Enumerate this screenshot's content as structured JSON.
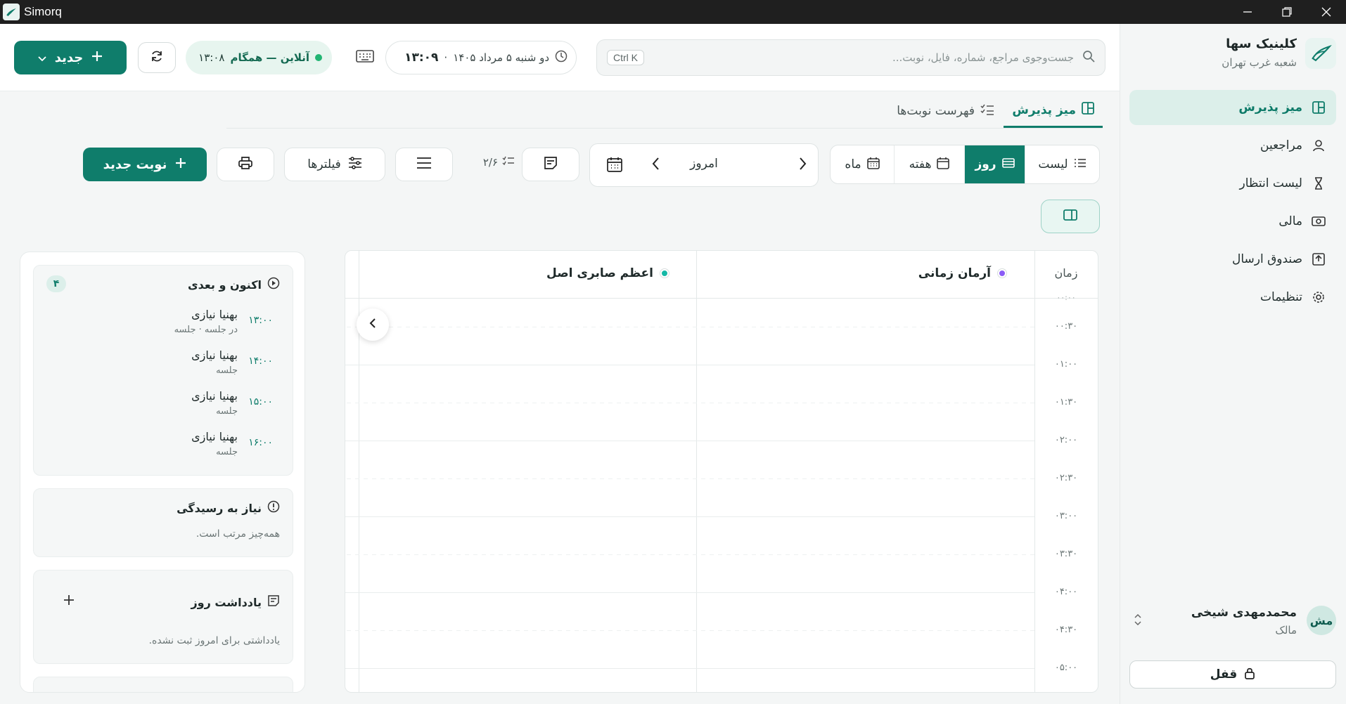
{
  "window": {
    "title": "Simorq"
  },
  "brand": {
    "name": "کلینیک سها",
    "branch": "شعبه غرب تهران"
  },
  "sidebar": {
    "items": [
      {
        "label": "میز پذیرش",
        "icon": "dashboard-icon",
        "active": true
      },
      {
        "label": "مراجعین",
        "icon": "user-icon"
      },
      {
        "label": "لیست انتظار",
        "icon": "hourglass-icon"
      },
      {
        "label": "مالی",
        "icon": "money-icon"
      },
      {
        "label": "صندوق ارسال",
        "icon": "outbox-icon"
      },
      {
        "label": "تنظیمات",
        "icon": "gear-icon"
      }
    ],
    "user": {
      "initials": "مش",
      "name": "محمدمهدی شیخی",
      "role": "مالک"
    },
    "lock_label": "قفل"
  },
  "header": {
    "search_placeholder": "جست‌وجوی مراجع، شماره، فایل، نوبت...",
    "search_shortcut": "Ctrl K",
    "date_text": "دو شنبه ۵ مرداد ۱۴۰۵",
    "time_text": "۱۳:۰۹",
    "online_label": "آنلاین — همگام",
    "online_time": "۱۳:۰۸",
    "new_label": "جدید"
  },
  "tabs": [
    {
      "label": "میز پذیرش",
      "active": true
    },
    {
      "label": "فهرست نوبت‌ها",
      "active": false
    }
  ],
  "toolbar": {
    "views": [
      {
        "label": "لیست",
        "active": false
      },
      {
        "label": "روز",
        "active": true
      },
      {
        "label": "هفته",
        "active": false
      },
      {
        "label": "ماه",
        "active": false
      }
    ],
    "today_label": "امروز",
    "count_label": "۲/۶",
    "filters_label": "فیلترها",
    "new_appointment_label": "نوبت جدید"
  },
  "schedule": {
    "time_header": "زمان",
    "providers": [
      {
        "name": "آرمان زمانی",
        "color": "#8b5cf6"
      },
      {
        "name": "اعظم صابری اصل",
        "color": "#14b8a6"
      }
    ],
    "times": [
      "۰۰:۳۰",
      "۰۱:۰۰",
      "۰۱:۳۰",
      "۰۲:۰۰",
      "۰۲:۳۰",
      "۰۳:۰۰",
      "۰۳:۳۰",
      "۰۴:۰۰",
      "۰۴:۳۰",
      "۰۵:۰۰"
    ]
  },
  "panel": {
    "now_next": {
      "title": "اکنون و بعدی",
      "count": "۴",
      "items": [
        {
          "name": "بهنیا نیازی",
          "time": "۱۳:۰۰",
          "sub": "در جلسه · جلسه"
        },
        {
          "name": "بهنیا نیازی",
          "time": "۱۴:۰۰",
          "sub": "جلسه"
        },
        {
          "name": "بهنیا نیازی",
          "time": "۱۵:۰۰",
          "sub": "جلسه"
        },
        {
          "name": "بهنیا نیازی",
          "time": "۱۶:۰۰",
          "sub": "جلسه"
        }
      ]
    },
    "attention": {
      "title": "نیاز به رسیدگی",
      "text": "همه‌چیز مرتب است."
    },
    "notes": {
      "title": "یادداشت روز",
      "text": "یادداشتی برای امروز ثبت نشده."
    }
  },
  "colors": {
    "accent": "#0f7d6b",
    "accent_light": "#dcefea"
  }
}
